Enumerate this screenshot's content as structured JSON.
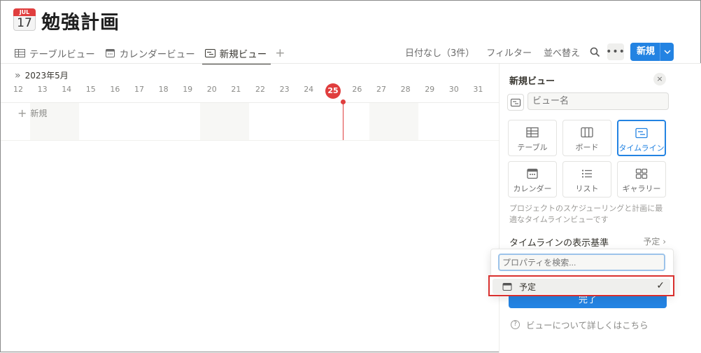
{
  "page": {
    "icon_month": "JUL",
    "icon_day": "17",
    "title": "勉強計画"
  },
  "tabs": [
    {
      "label": "テーブルビュー",
      "icon": "table-icon"
    },
    {
      "label": "カレンダービュー",
      "icon": "calendar-icon"
    },
    {
      "label": "新規ビュー",
      "icon": "timeline-icon",
      "active": true
    }
  ],
  "toolbar": {
    "no_date": "日付なし（3件）",
    "filter": "フィルター",
    "sort": "並べ替え",
    "more": "•••",
    "new": "新規"
  },
  "timeline": {
    "month": "2023年5月",
    "days": [
      "12",
      "13",
      "14",
      "15",
      "16",
      "17",
      "18",
      "19",
      "20",
      "21",
      "22",
      "23",
      "24",
      "25",
      "26",
      "27",
      "28",
      "29",
      "30",
      "31"
    ],
    "today": "25",
    "new_label": "新規"
  },
  "panel": {
    "title": "新規ビュー",
    "close": "×",
    "name_placeholder": "ビュー名",
    "layouts": [
      {
        "label": "テーブル",
        "icon": "table-icon"
      },
      {
        "label": "ボード",
        "icon": "board-icon"
      },
      {
        "label": "タイムライン",
        "icon": "timeline-icon",
        "selected": true
      },
      {
        "label": "カレンダー",
        "icon": "calendar-icon"
      },
      {
        "label": "リスト",
        "icon": "list-icon"
      },
      {
        "label": "ギャラリー",
        "icon": "gallery-icon"
      }
    ],
    "description": "プロジェクトのスケジューリングと計画に最適なタイムラインビューです",
    "timeline_basis_label": "タイムラインの表示基準",
    "timeline_basis_value": "予定",
    "done": "完了",
    "help": "ビューについて詳しくはこちら"
  },
  "dropdown": {
    "search_placeholder": "プロパティを検索...",
    "option": "予定",
    "check": "✓"
  },
  "colors": {
    "accent": "#2383e2",
    "today": "#e03e3e",
    "highlight_border": "#d9312f"
  }
}
